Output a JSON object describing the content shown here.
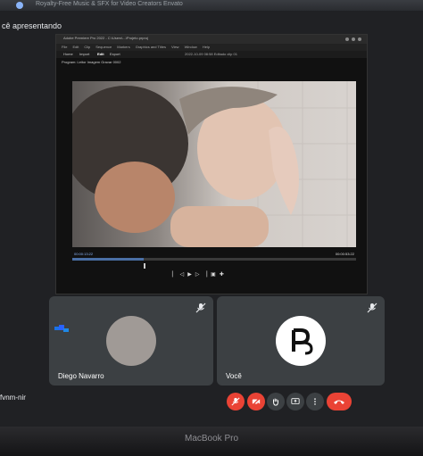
{
  "browser": {
    "tab_title": "Royalty-Free Music & SFX for Video Creators Envato"
  },
  "meet": {
    "presenting_label": "cê apresentando",
    "meeting_code": "fvnm-nir"
  },
  "shared_window": {
    "title": "Adobe Premiere Pro 2022 - C:\\Users\\...\\Projeto.prproj",
    "menu": [
      "File",
      "Edit",
      "Clip",
      "Sequence",
      "Markers",
      "Graphics and Titles",
      "View",
      "Window",
      "Help"
    ],
    "tabs": [
      "Home",
      "Import",
      "Edit",
      "Export"
    ],
    "center_title": "2022-10-09 08:58 Editado clip 01",
    "breadcrumb": "Program: Leitor Imagem Gravar 0002",
    "timecode_left": "00:00:13:22",
    "timecode_right": "00:00:53:22",
    "progress": 0.25
  },
  "participants": [
    {
      "name": "Diego Navarro",
      "muted": true
    },
    {
      "name": "Você",
      "muted": true,
      "avatar_logo": "P"
    }
  ],
  "controls": [
    {
      "icon": "mic-off-icon"
    },
    {
      "icon": "camera-off-icon"
    },
    {
      "icon": "raise-hand-icon"
    },
    {
      "icon": "present-icon"
    },
    {
      "icon": "more-options-icon"
    },
    {
      "icon": "end-call-icon"
    }
  ],
  "laptop": {
    "label": "MacBook Pro"
  },
  "colors": {
    "danger": "#ea4335",
    "tile": "#3c4043",
    "background": "#202124",
    "accent": "#8ab4f8"
  }
}
